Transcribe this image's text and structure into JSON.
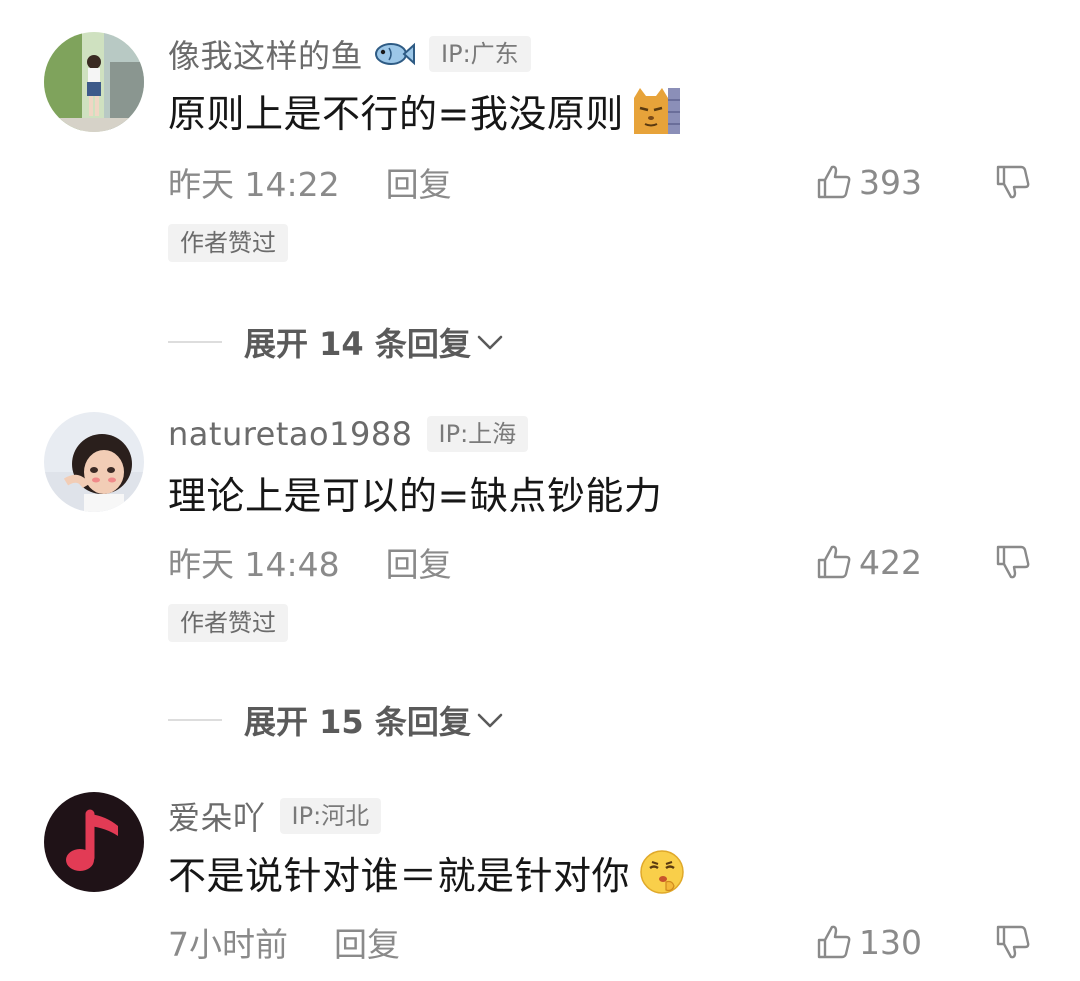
{
  "comments": [
    {
      "username": "像我这样的鱼",
      "name_emoji": "fish-icon",
      "ip": "IP:广东",
      "text": "原则上是不行的=我没原则",
      "text_emoji": "cat-peeking-icon",
      "time": "昨天 14:22",
      "reply_label": "回复",
      "likes": "393",
      "author_liked": "作者赞过",
      "expand_label": "展开 14 条回复"
    },
    {
      "username": "naturetao1988",
      "ip": "IP:上海",
      "text": "理论上是可以的=缺点钞能力",
      "time": "昨天 14:48",
      "reply_label": "回复",
      "likes": "422",
      "author_liked": "作者赞过",
      "expand_label": "展开 15 条回复"
    },
    {
      "username": "爱朵吖",
      "ip": "IP:河北",
      "text": "不是说针对谁＝就是针对你",
      "text_emoji": "shushing-face-icon",
      "time": "7小时前",
      "reply_label": "回复",
      "likes": "130"
    }
  ],
  "colors": {
    "secondary_text": "#8a8a8a",
    "badge_bg": "#f2f2f2",
    "music_avatar_bg": "#1f1217",
    "music_note": "#e23b55"
  }
}
